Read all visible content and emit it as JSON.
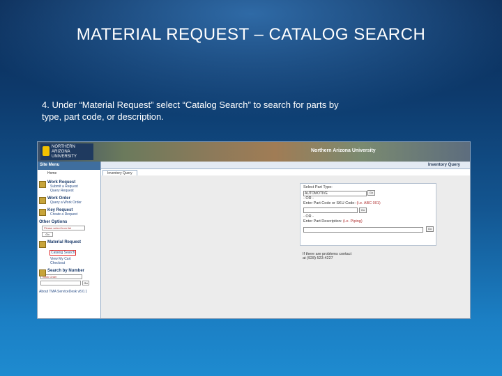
{
  "slide": {
    "title": "MATERIAL REQUEST – CATALOG SEARCH",
    "instruction": "4. Under “Material Request” select “Catalog Search” to search for parts by type, part code, or description."
  },
  "banner": {
    "logo_line1": "NORTHERN",
    "logo_line2": "ARIZONA",
    "logo_line3": "UNIVERSITY",
    "university": "Northern Arizona University"
  },
  "sidebar": {
    "menu_title": "Site Menu",
    "home": "Home",
    "work_request": {
      "title": "Work Request",
      "items": [
        "Submit a Request",
        "Query Request"
      ]
    },
    "work_order": {
      "title": "Work Order",
      "items": [
        "Query a Work Order"
      ]
    },
    "key_request": {
      "title": "Key Request",
      "items": [
        "Create a Request"
      ]
    },
    "other_options": {
      "title": "Other Options",
      "select_value": "Please select from list",
      "go": "Go"
    },
    "material_request": {
      "title": "Material Request",
      "items": [
        "Catalog Search",
        "View My Cart",
        "Checkout"
      ]
    },
    "search_by_number": {
      "title": "Search by Number",
      "select_value": "Work Order",
      "go": "Go"
    },
    "about": "About TMA ServiceDesk v8.0.1"
  },
  "main": {
    "title": "Inventory Query",
    "tab": "Inventory Query",
    "form": {
      "part_type_label": "Select Part Type:",
      "part_type_value": "AUTOMOTIVE",
      "or1": "- OR -",
      "code_label": "Enter Part Code or SKU Code:",
      "code_hint": "(i.e. ABC 001)",
      "or2": "- OR -",
      "desc_label": "Enter Part Description:",
      "desc_hint": "(i.e. Piping)",
      "go": "Go"
    },
    "note_line1": "If there are problems contact",
    "note_line2": "at (928) 523-4227"
  }
}
